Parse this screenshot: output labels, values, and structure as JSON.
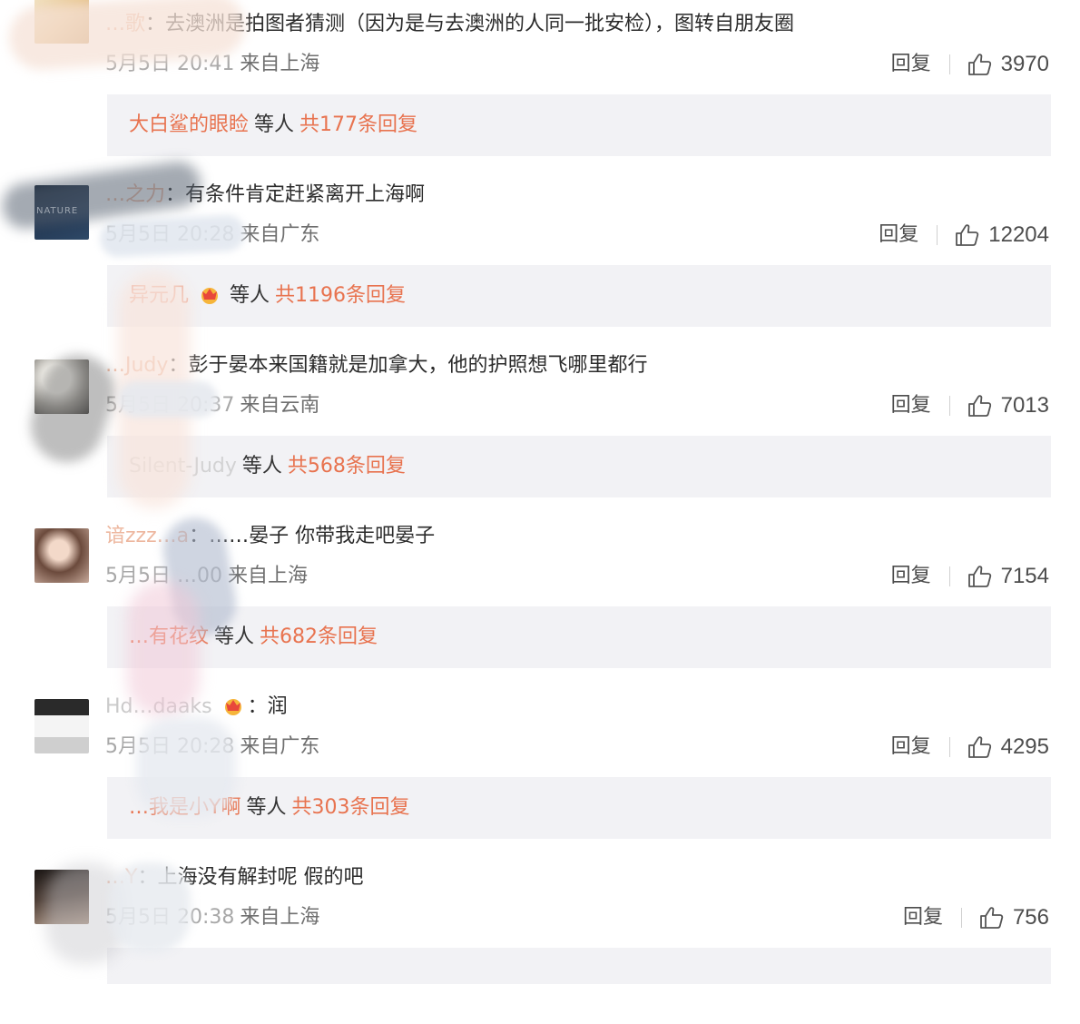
{
  "comments": [
    {
      "username": "…歌",
      "text": "去澳洲是拍图者猜测（因为是与去澳洲的人同一批安检），图转自朋友圈",
      "date": "5月5日 20:41",
      "location": "来自上海",
      "reply_label": "回复",
      "likes": "3970",
      "reply_preview": {
        "name": "大白鲨的眼睑",
        "mid": "等人",
        "count": "共177条回复"
      }
    },
    {
      "username": "…之力",
      "avatar_text": "NATURE",
      "text": "有条件肯定赶紧离开上海啊",
      "date": "5月5日 20:28",
      "location": "来自广东",
      "reply_label": "回复",
      "likes": "12204",
      "reply_preview": {
        "name": "异元几",
        "mid": "等人",
        "count": "共1196条回复"
      }
    },
    {
      "username": "…Judy",
      "text": "彭于晏本来国籍就是加拿大，他的护照想飞哪里都行",
      "date": "5月5日 20:37",
      "location": "来自云南",
      "reply_label": "回复",
      "likes": "7013",
      "reply_preview": {
        "name": "Silent-Judy",
        "mid": "等人",
        "count": "共568条回复"
      }
    },
    {
      "username": "谙zzz…a",
      "text": "……晏子 你带我走吧晏子",
      "date": "5月5日 …00",
      "location": "来自上海",
      "reply_label": "回复",
      "likes": "7154",
      "reply_preview": {
        "name": "…有花纹",
        "mid": "等人",
        "count": "共682条回复"
      }
    },
    {
      "username": "Hd…daaks",
      "text": "润",
      "date": "5月5日 20:28",
      "location": "来自广东",
      "reply_label": "回复",
      "likes": "4295",
      "reply_preview": {
        "name": "…我是小Y啊",
        "mid": "等人",
        "count": "共303条回复"
      }
    },
    {
      "username": "…Y",
      "text": "上海没有解封呢 假的吧",
      "date": "5月5日 20:38",
      "location": "来自上海",
      "reply_label": "回复",
      "likes": "756"
    }
  ],
  "colors": {
    "accent": "#e8734f",
    "username": "#e8a07f",
    "reply_bg": "#f2f2f5",
    "muted": "#8a8a8a"
  },
  "icons": {
    "like": "thumbs-up-icon",
    "badge": "crown-badge-icon"
  }
}
